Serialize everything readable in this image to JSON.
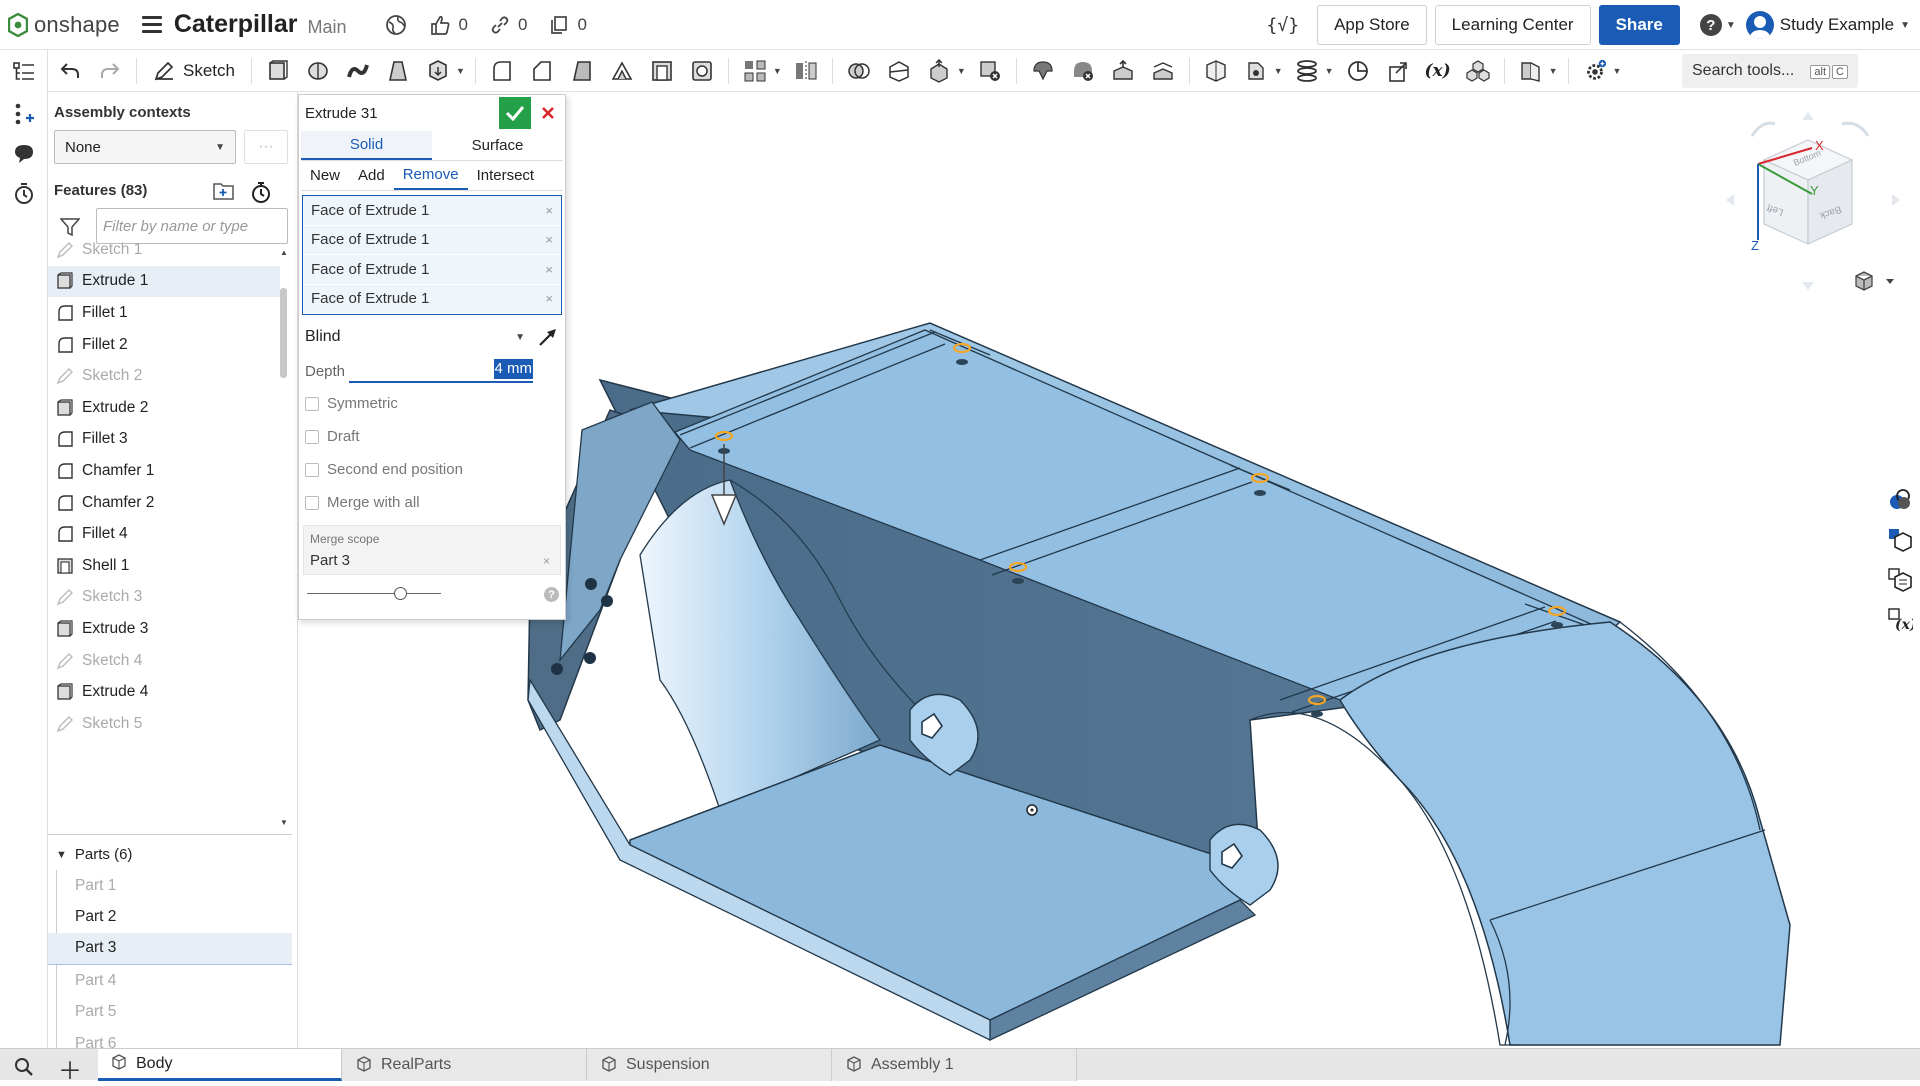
{
  "topbar": {
    "brand": "onshape",
    "document_title": "Caterpillar",
    "branch": "Main",
    "likes": "0",
    "links": "0",
    "copies": "0",
    "variable_button": "{√}",
    "app_store": "App Store",
    "learning_center": "Learning Center",
    "share": "Share",
    "help": "?",
    "user": "Study Example"
  },
  "toolbar": {
    "sketch_label": "Sketch",
    "search_label": "Search tools...",
    "search_key_alt": "alt",
    "search_key_c": "C"
  },
  "feature_panel": {
    "assembly_contexts_title": "Assembly contexts",
    "assembly_contexts_value": "None",
    "more_button": "···",
    "features_title": "Features (83)",
    "filter_placeholder": "Filter by name or type",
    "features": [
      {
        "label": "Sketch 1",
        "type": "sketch",
        "dim": true
      },
      {
        "label": "Extrude 1",
        "type": "extrude",
        "dim": false,
        "selected": true
      },
      {
        "label": "Fillet 1",
        "type": "fillet",
        "dim": false
      },
      {
        "label": "Fillet 2",
        "type": "fillet",
        "dim": false
      },
      {
        "label": "Sketch 2",
        "type": "sketch",
        "dim": true
      },
      {
        "label": "Extrude 2",
        "type": "extrude",
        "dim": false
      },
      {
        "label": "Fillet 3",
        "type": "fillet",
        "dim": false
      },
      {
        "label": "Chamfer 1",
        "type": "fillet",
        "dim": false
      },
      {
        "label": "Chamfer 2",
        "type": "fillet",
        "dim": false
      },
      {
        "label": "Fillet 4",
        "type": "fillet",
        "dim": false
      },
      {
        "label": "Shell 1",
        "type": "shell",
        "dim": false
      },
      {
        "label": "Sketch 3",
        "type": "sketch",
        "dim": true
      },
      {
        "label": "Extrude 3",
        "type": "extrude",
        "dim": false
      },
      {
        "label": "Sketch 4",
        "type": "sketch",
        "dim": true
      },
      {
        "label": "Extrude 4",
        "type": "extrude",
        "dim": false
      },
      {
        "label": "Sketch 5",
        "type": "sketch",
        "dim": true
      }
    ],
    "parts_title": "Parts (6)",
    "parts": [
      {
        "label": "Part 1",
        "state": "dim"
      },
      {
        "label": "Part 2",
        "state": "active"
      },
      {
        "label": "Part 3",
        "state": "selected"
      },
      {
        "label": "Part 4",
        "state": "dim"
      },
      {
        "label": "Part 5",
        "state": "dim"
      },
      {
        "label": "Part 6",
        "state": "dim"
      }
    ]
  },
  "dialog": {
    "title": "Extrude 31",
    "tab_solid": "Solid",
    "tab_surface": "Surface",
    "op_new": "New",
    "op_add": "Add",
    "op_remove": "Remove",
    "op_intersect": "Intersect",
    "faces": [
      "Face of Extrude 1",
      "Face of Extrude 1",
      "Face of Extrude 1",
      "Face of Extrude 1"
    ],
    "remove_mark": "×",
    "end_type": "Blind",
    "depth_label": "Depth",
    "depth_value": "4 mm",
    "symmetric": "Symmetric",
    "draft": "Draft",
    "second_end": "Second end position",
    "merge_all": "Merge with all",
    "merge_scope_label": "Merge scope",
    "merge_scope_value": "Part 3",
    "help": "?"
  },
  "view_cube": {
    "axis_x": "X",
    "axis_y": "Y",
    "axis_z": "Z",
    "face_bottom": "Bottom",
    "face_left": "Left",
    "face_back": "Back"
  },
  "bottom_tabs": [
    {
      "label": "Body",
      "active": true
    },
    {
      "label": "RealParts",
      "active": false
    },
    {
      "label": "Suspension",
      "active": false
    },
    {
      "label": "Assembly 1",
      "active": false
    }
  ],
  "colors": {
    "accent": "#1a5bb5",
    "confirm_green": "#24a148",
    "cancel_red": "#d9262e",
    "model_blue": "#8fbcdf",
    "model_shade": "#4f6d86",
    "highlight_orange": "#f5a623"
  }
}
